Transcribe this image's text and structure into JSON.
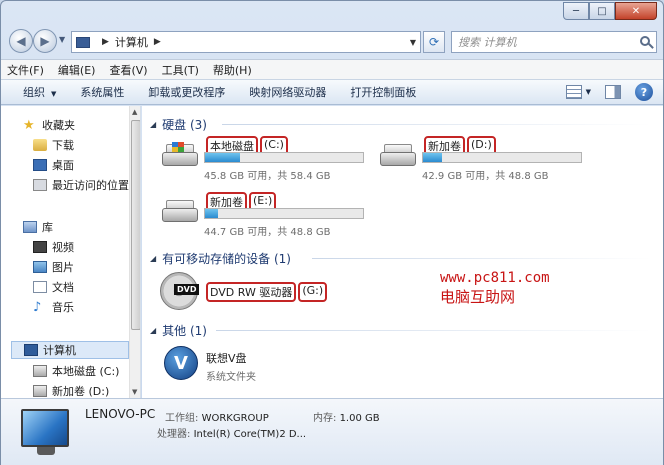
{
  "window": {
    "caption_minimize": "─",
    "caption_maximize": "□",
    "caption_close": "✕"
  },
  "address": {
    "path": [
      "计算机"
    ],
    "search_placeholder": "搜索 计算机"
  },
  "menu": [
    "文件(F)",
    "编辑(E)",
    "查看(V)",
    "工具(T)",
    "帮助(H)"
  ],
  "toolbar": {
    "organize": "组织",
    "commands": [
      "系统属性",
      "卸载或更改程序",
      "映射网络驱动器",
      "打开控制面板"
    ]
  },
  "nav": {
    "favorites": "收藏夹",
    "favorites_items": [
      "下载",
      "桌面",
      "最近访问的位置"
    ],
    "libraries": "库",
    "libraries_items": [
      "视频",
      "图片",
      "文档",
      "音乐"
    ],
    "computer": "计算机",
    "computer_items": [
      "本地磁盘 (C:)",
      "新加卷 (D:)"
    ]
  },
  "groups": {
    "hdd": "硬盘 (3)",
    "removable": "有可移动存储的设备 (1)",
    "other": "其他 (1)"
  },
  "drives": [
    {
      "name": "本地磁盘",
      "letter": "(C:)",
      "size": "45.8 GB 可用，共 58.4 GB",
      "used_fraction": 0.22
    },
    {
      "name": "新加卷",
      "letter": "(D:)",
      "size": "42.9 GB 可用，共 48.8 GB",
      "used_fraction": 0.12
    },
    {
      "name": "新加卷",
      "letter": "(E:)",
      "size": "44.7 GB 可用，共 48.8 GB",
      "used_fraction": 0.08
    }
  ],
  "dvd": {
    "name": "DVD RW 驱动器",
    "letter": "(G:)",
    "badge": "DVD"
  },
  "other_item": {
    "name": "联想V盘",
    "sub": "系统文件夹",
    "badge": "V"
  },
  "watermark": {
    "url": "www.pc811.com",
    "name": "电脑互助网"
  },
  "details": {
    "pc_name": "LENOVO-PC",
    "workgroup_label": "工作组:",
    "workgroup": "WORKGROUP",
    "memory_label": "内存:",
    "memory": "1.00 GB",
    "cpu_label": "处理器:",
    "cpu": "Intel(R) Core(TM)2 D..."
  }
}
